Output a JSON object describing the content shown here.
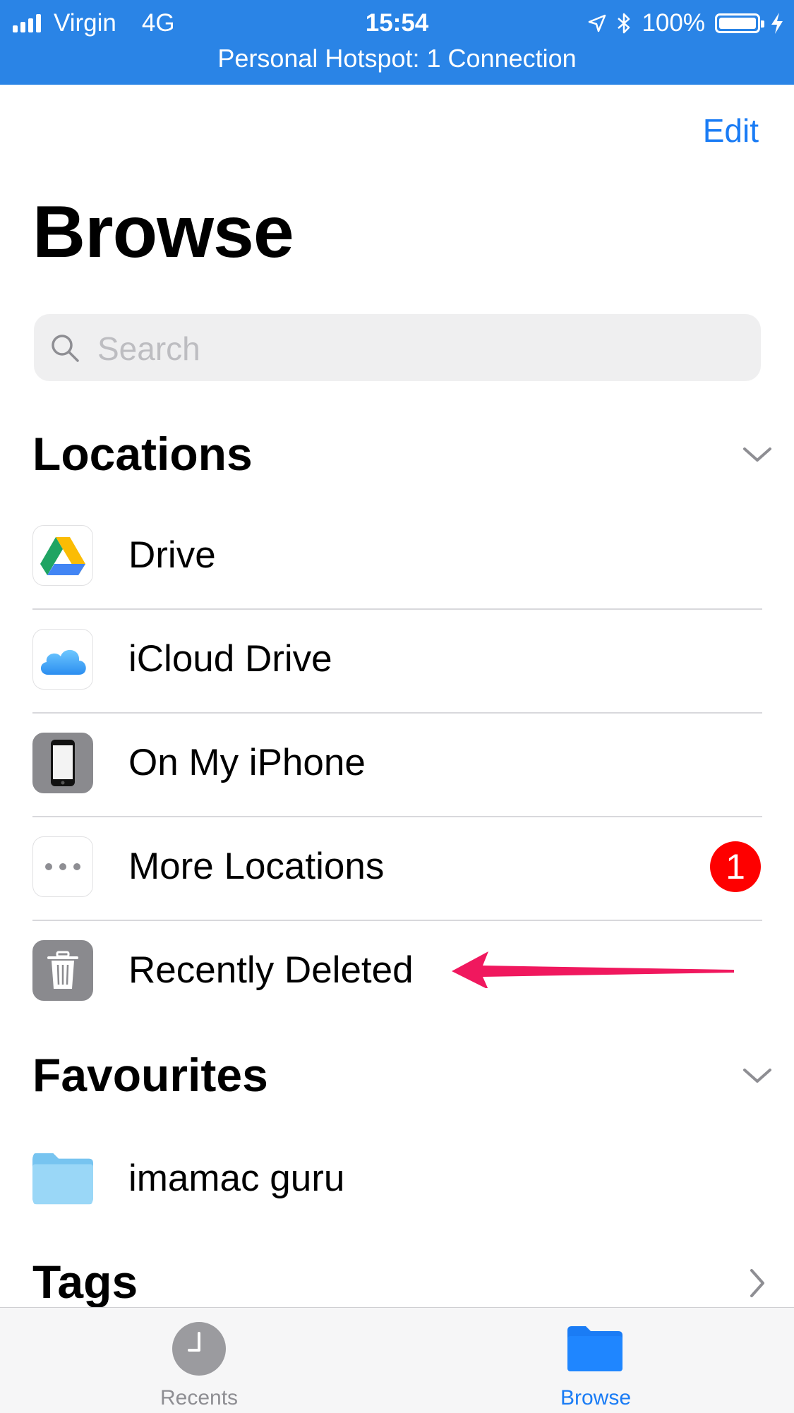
{
  "status_bar": {
    "carrier": "Virgin",
    "network": "4G",
    "time": "15:54",
    "battery": "100%",
    "hotspot": "Personal Hotspot: 1 Connection"
  },
  "nav": {
    "edit_label": "Edit"
  },
  "page_title": "Browse",
  "search": {
    "placeholder": "Search"
  },
  "locations": {
    "header": "Locations",
    "items": [
      {
        "label": "Drive",
        "icon": "google-drive-icon"
      },
      {
        "label": "iCloud Drive",
        "icon": "icloud-icon"
      },
      {
        "label": "On My iPhone",
        "icon": "iphone-icon"
      },
      {
        "label": "More Locations",
        "icon": "more-icon",
        "badge": "1"
      },
      {
        "label": "Recently Deleted",
        "icon": "trash-icon"
      }
    ]
  },
  "favourites": {
    "header": "Favourites",
    "items": [
      {
        "label": "imamac guru",
        "icon": "folder-icon"
      }
    ]
  },
  "tags": {
    "header": "Tags"
  },
  "tab_bar": {
    "tabs": [
      {
        "label": "Recents",
        "icon": "clock-icon",
        "active": false
      },
      {
        "label": "Browse",
        "icon": "folder-icon",
        "active": true
      }
    ]
  },
  "colors": {
    "status_bar": "#2a84e6",
    "accent": "#1a7cf5",
    "badge": "#fe0000",
    "annotation_arrow": "#f0185e"
  }
}
